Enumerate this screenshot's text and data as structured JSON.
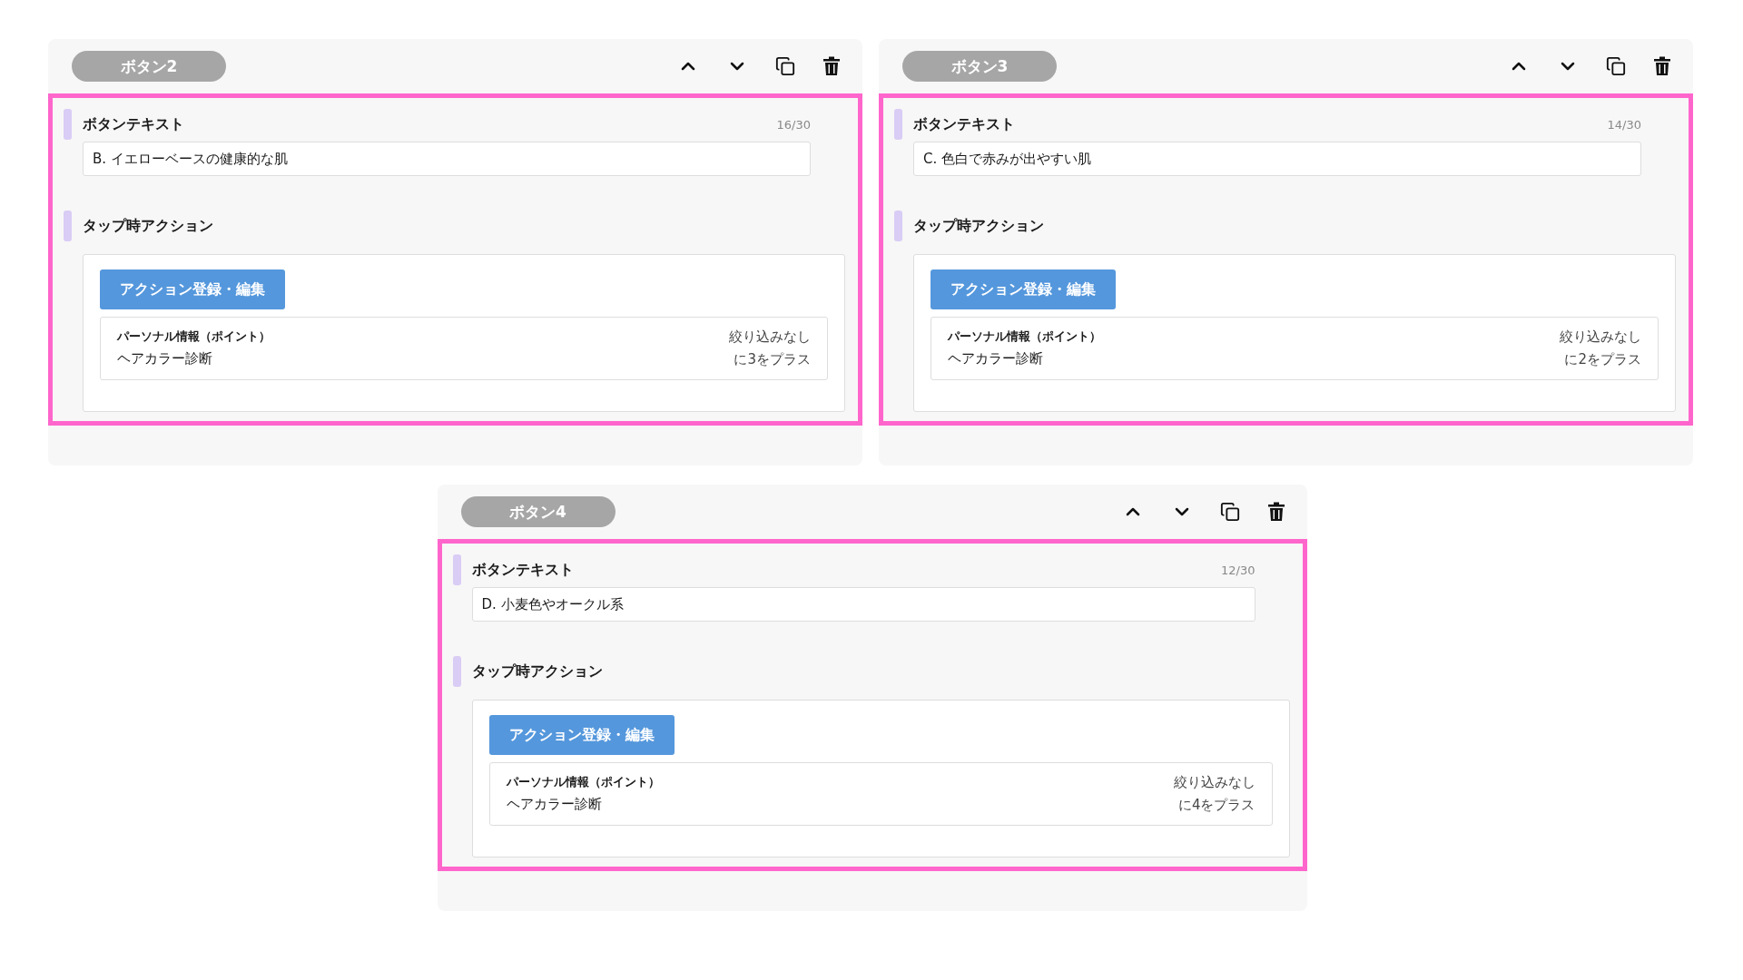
{
  "cards": [
    {
      "badge": "ボタン2",
      "text_label": "ボタンテキスト",
      "counter": "16/30",
      "value": "B. イエローベースの健康的な肌",
      "action_label": "タップ時アクション",
      "action_button": "アクション登録・編集",
      "info_title": "パーソナル情報（ポイント）",
      "info_detail": "ヘアカラー診断",
      "filter": "絞り込みなし",
      "plus": "に3をプラス",
      "highlighted": true
    },
    {
      "badge": "ボタン3",
      "text_label": "ボタンテキスト",
      "counter": "14/30",
      "value": "C. 色白で赤みが出やすい肌",
      "action_label": "タップ時アクション",
      "action_button": "アクション登録・編集",
      "info_title": "パーソナル情報（ポイント）",
      "info_detail": "ヘアカラー診断",
      "filter": "絞り込みなし",
      "plus": "に2をプラス",
      "highlighted": true
    },
    {
      "badge": "ボタン4",
      "text_label": "ボタンテキスト",
      "counter": "12/30",
      "value": "D. 小麦色やオークル系",
      "action_label": "タップ時アクション",
      "action_button": "アクション登録・編集",
      "info_title": "パーソナル情報（ポイント）",
      "info_detail": "ヘアカラー診断",
      "filter": "絞り込みなし",
      "plus": "に4をプラス",
      "highlighted": true
    }
  ]
}
